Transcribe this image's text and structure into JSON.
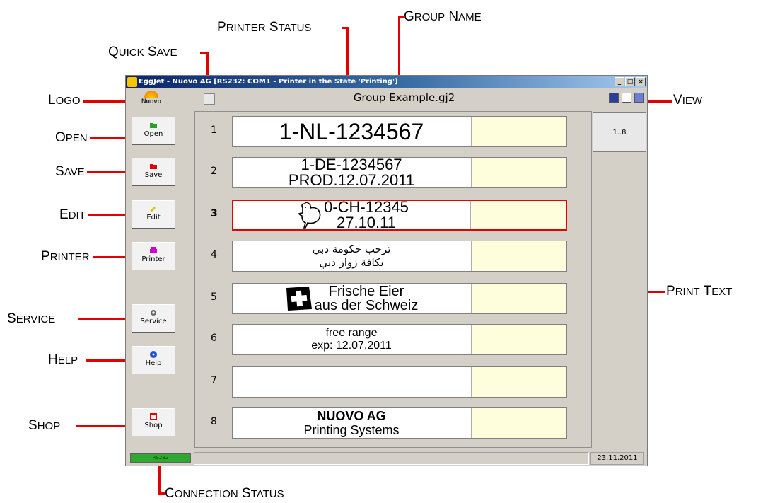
{
  "callouts": {
    "logo": "Logo",
    "open": "Open",
    "save": "Save",
    "edit": "Edit",
    "printer": "Printer",
    "service": "Service",
    "help": "Help",
    "shop": "Shop",
    "quick_save": "Quick Save",
    "printer_status": "Printer Status",
    "group_name": "Group Name",
    "view": "View",
    "print_text": "Print Text",
    "connection_status": "Connection Status"
  },
  "window": {
    "title": "EggJet - Nuovo AG   [RS232: COM1 - Printer in the State 'Printing']",
    "logo_text": "Nuovo",
    "group_name": "Group Example.gj2",
    "tab_label": "1..8",
    "date": "23.11.2011",
    "connection_text": "RS232"
  },
  "sidebar": [
    {
      "label": "Open",
      "icon": "folder-icon",
      "color": "#2aa02a"
    },
    {
      "label": "Save",
      "icon": "save-icon",
      "color": "#e00000"
    },
    {
      "label": "Edit",
      "icon": "edit-icon",
      "color": "#e0c000"
    },
    {
      "label": "Printer",
      "icon": "printer-icon",
      "color": "#d000d0"
    },
    {
      "label": "Service",
      "icon": "gear-icon",
      "color": "#666666"
    },
    {
      "label": "Help",
      "icon": "help-icon",
      "color": "#1e50d8"
    },
    {
      "label": "Shop",
      "icon": "cart-icon",
      "color": "#e00000"
    }
  ],
  "rows": [
    {
      "num": "1",
      "lines": [
        "1-NL-1234567"
      ]
    },
    {
      "num": "2",
      "lines": [
        "1-DE-1234567",
        "PROD.12.07.2011"
      ]
    },
    {
      "num": "3",
      "lines": [
        "0-CH-12345",
        "27.10.11"
      ],
      "selected": true,
      "icon": "chicken-icon"
    },
    {
      "num": "4",
      "lines": [
        "ترحب حكومة دبي",
        "بكافة زوار دبي"
      ]
    },
    {
      "num": "5",
      "lines": [
        "Frische Eier",
        "aus der Schweiz"
      ],
      "icon": "swiss-flag-icon"
    },
    {
      "num": "6",
      "lines": [
        "free range",
        "exp: 12.07.2011"
      ]
    },
    {
      "num": "7",
      "lines": []
    },
    {
      "num": "8",
      "lines": [
        "NUOVO AG",
        "Printing Systems"
      ]
    }
  ]
}
